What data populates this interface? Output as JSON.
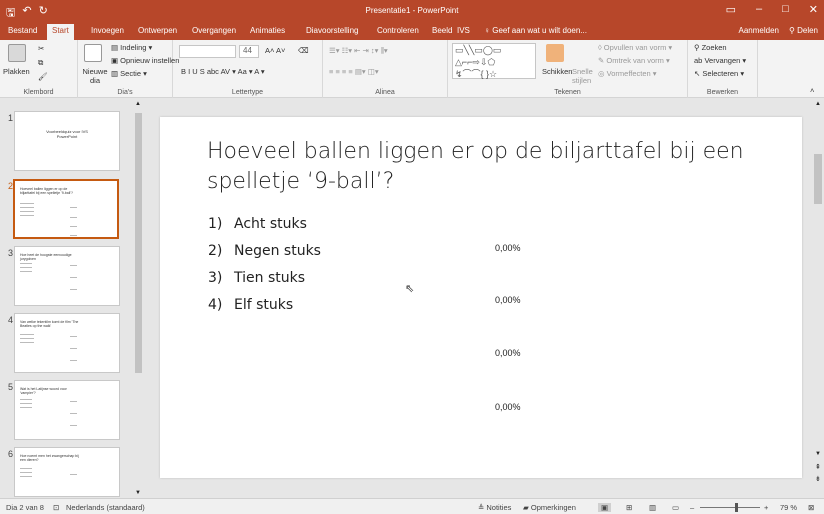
{
  "window": {
    "title": "Presentatie1 - PowerPoint"
  },
  "qat": {
    "save": "🖫",
    "undo": "↶",
    "redo": "↻"
  },
  "tabs": [
    {
      "label": "Bestand"
    },
    {
      "label": "Start"
    },
    {
      "label": "Invoegen"
    },
    {
      "label": "Ontwerpen"
    },
    {
      "label": "Overgangen"
    },
    {
      "label": "Animaties"
    },
    {
      "label": "Diavoorstelling"
    },
    {
      "label": "Controleren"
    },
    {
      "label": "Beeld"
    },
    {
      "label": "IVS"
    }
  ],
  "tellme": "Geef aan wat u wilt doen...",
  "account": {
    "signin": "Aanmelden",
    "share": "Delen"
  },
  "ribbon": {
    "clipboard": {
      "paste": "Plakken",
      "group": "Klembord"
    },
    "slides": {
      "new_slide": "Nieuwe dia",
      "layout": "Indeling",
      "reset": "Opnieuw instellen",
      "section": "Sectie",
      "group": "Dia's"
    },
    "font": {
      "size": "44",
      "group": "Lettertype"
    },
    "paragraph": {
      "group": "Alinea"
    },
    "drawing": {
      "arrange": "Schikken",
      "quick_styles": "Snelle stijlen",
      "fill": "Opvullen van vorm",
      "outline": "Omtrek van vorm",
      "effects": "Vormeffecten",
      "group": "Tekenen"
    },
    "editing": {
      "find": "Zoeken",
      "replace": "Vervangen",
      "select": "Selecteren",
      "group": "Bewerken"
    }
  },
  "thumbnails": [
    {
      "num": "1",
      "title": "Voorbeeldquiz voor IVS PowerPoint"
    },
    {
      "num": "2",
      "title": "Hoeveel ballen liggen er op de biljarttafel bij een spelletje '9-ball'?"
    },
    {
      "num": "3",
      "title": "Hoe heet de hoogste eenvoudige jurygolven"
    },
    {
      "num": "4",
      "title": "Van welke tekentilm komt de film 'The Beatles op the walk'"
    },
    {
      "num": "5",
      "title": "Wat is het Latijnse woord voor 'vampier'?"
    },
    {
      "num": "6",
      "title": "Hoe noemt men het zwangerschap bij een dieren?"
    }
  ],
  "slide": {
    "title": "Hoeveel ballen liggen er op de biljarttafel bij een spelletje ‘9-ball’?",
    "answers": [
      {
        "num": "1)",
        "text": "Acht stuks"
      },
      {
        "num": "2)",
        "text": "Negen stuks"
      },
      {
        "num": "3)",
        "text": "Tien stuks"
      },
      {
        "num": "4)",
        "text": "Elf stuks"
      }
    ],
    "percentages": [
      "0,00%",
      "0,00%",
      "0,00%",
      "0,00%"
    ]
  },
  "status": {
    "slide_of": "Dia 2 van 8",
    "language": "Nederlands (standaard)",
    "notes": "Notities",
    "comments": "Opmerkingen",
    "zoom": "79 %"
  },
  "colors": {
    "accent": "#b7472a",
    "selection": "#c55a11"
  }
}
